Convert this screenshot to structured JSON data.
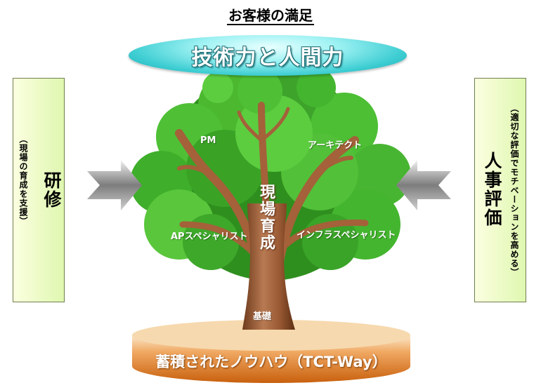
{
  "header": {
    "title": "お客様の満足"
  },
  "banner": {
    "text": "技術力と人間力"
  },
  "left_panel": {
    "title": "研修",
    "subtitle": "（現場の育成を支援）"
  },
  "right_panel": {
    "title": "人事評価",
    "subtitle": "（適切な評価でモチベーションを高める）"
  },
  "tree": {
    "center_label": "現場育成",
    "labels": {
      "pm": "PM",
      "architect": "アーキテクト",
      "ap_specialist": "APスペシャリスト",
      "infra_specialist": "インフラスペシャリスト",
      "foundation": "基礎"
    }
  },
  "base": {
    "text": "蓄積されたノウハウ（TCT-Way）"
  },
  "colors": {
    "banner": "#3ccdd2",
    "foliage": "#3fae2a",
    "trunk": "#a0603a",
    "base": "#e0822a",
    "side_box": "#eefcc6",
    "arrow": "#8a8a8a"
  }
}
